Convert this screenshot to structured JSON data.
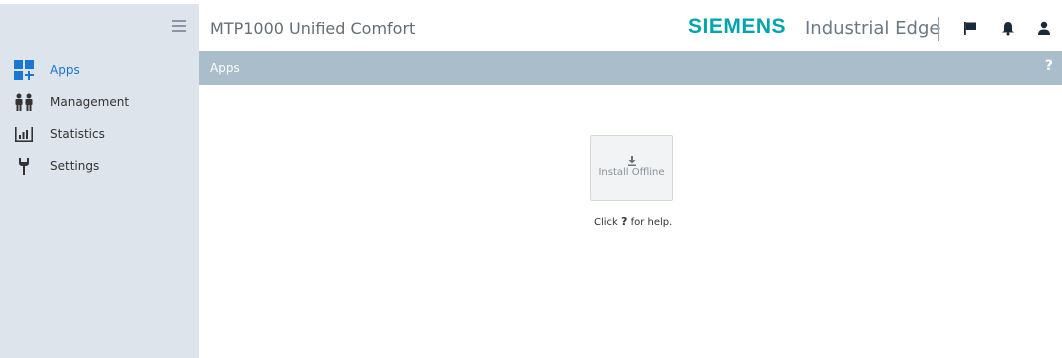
{
  "header": {
    "title": "MTP1000 Unified Comfort",
    "brand": "SIEMENS",
    "product": "Industrial Edge"
  },
  "sidebar": {
    "items": [
      {
        "label": "Apps",
        "icon": "apps-icon",
        "active": true
      },
      {
        "label": "Management",
        "icon": "management-icon",
        "active": false
      },
      {
        "label": "Statistics",
        "icon": "statistics-icon",
        "active": false
      },
      {
        "label": "Settings",
        "icon": "settings-icon",
        "active": false
      }
    ]
  },
  "page": {
    "title": "Apps",
    "help_glyph": "?"
  },
  "content": {
    "install_label": "Install Offline",
    "help_prefix": "Click",
    "help_glyph": "?",
    "help_suffix": "for help."
  },
  "colors": {
    "brand": "#00a5ab",
    "active": "#1976d2",
    "titlebar": "#aabdcb",
    "sidebar": "#dde4ec"
  }
}
